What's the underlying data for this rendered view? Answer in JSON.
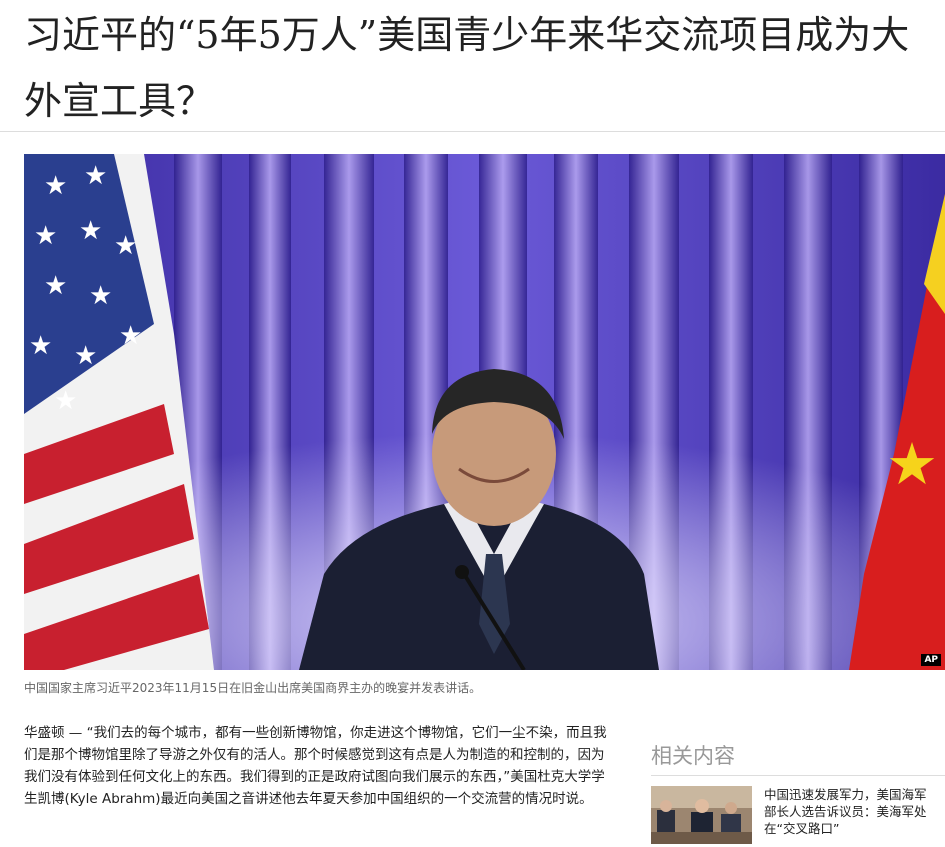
{
  "article": {
    "headline": "习近平的“5年5万人”美国青少年来华交流项目成为大外宣工具？",
    "photo_credit": "AP",
    "caption": "中国国家主席习近平2023年11月15日在旧金山出席美国商界主办的晚宴并发表讲话。",
    "body": "华盛顿 —  “我们去的每个城市，都有一些创新博物馆，你走进这个博物馆，它们一尘不染，而且我们是那个博物馆里除了导游之外仅有的活人。那个时候感觉到这有点是人为制造的和控制的，因为我们没有体验到任何文化上的东西。我们得到的正是政府试图向我们展示的东西，”美国杜克大学学生凯博(Kyle Abrahm)最近向美国之音讲述他去年夏天参加中国组织的一个交流营的情况时说。"
  },
  "related": {
    "title": "相关内容",
    "items": [
      {
        "text": "中国迅速发展军力，美国海军部长人选告诉议员：美海军处在“交叉路口”"
      }
    ]
  }
}
